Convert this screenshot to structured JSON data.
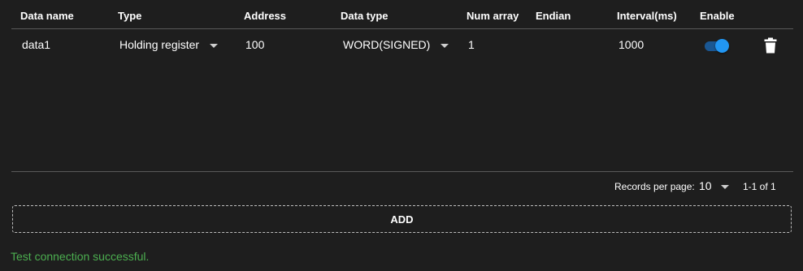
{
  "table": {
    "headers": {
      "data_name": "Data name",
      "type": "Type",
      "address": "Address",
      "data_type": "Data type",
      "num_array": "Num array",
      "endian": "Endian",
      "interval": "Interval(ms)",
      "enable": "Enable"
    },
    "rows": [
      {
        "data_name": "data1",
        "type": "Holding register",
        "address": "100",
        "data_type": "WORD(SIGNED)",
        "num_array": "1",
        "endian": "",
        "interval": "1000",
        "enabled": true
      }
    ]
  },
  "pagination": {
    "records_per_page_label": "Records per page:",
    "records_per_page_value": "10",
    "range": "1-1 of 1"
  },
  "add_button": {
    "label": "ADD"
  },
  "status": {
    "message": "Test connection successful.",
    "color": "#4caf50"
  },
  "colors": {
    "accent": "#2196f3",
    "background": "#1e1e1e"
  },
  "icons": {
    "delete": "trash-icon",
    "dropdown": "chevron-down-icon"
  }
}
